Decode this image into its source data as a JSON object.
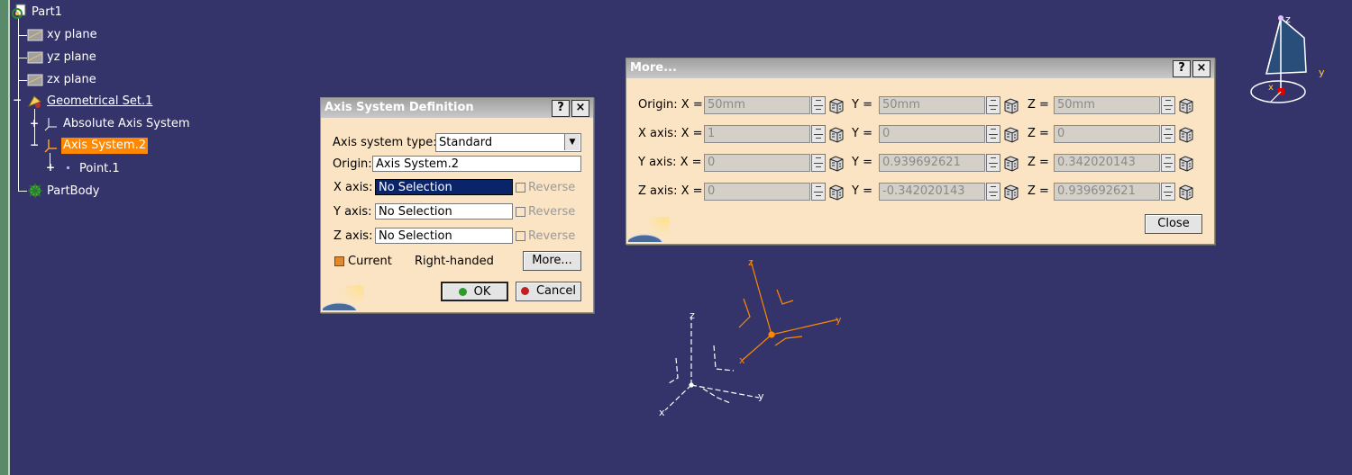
{
  "tree": {
    "root": "Part1",
    "items": [
      {
        "label": "xy plane"
      },
      {
        "label": "yz plane"
      },
      {
        "label": "zx plane"
      },
      {
        "label": "Geometrical Set.1"
      },
      {
        "label": "Absolute Axis System"
      },
      {
        "label": "Axis System.2"
      },
      {
        "label": "Point.1"
      },
      {
        "label": "PartBody"
      }
    ]
  },
  "axis_dialog": {
    "title": "Axis System Definition",
    "help": "?",
    "close": "×",
    "type_label": "Axis system type:",
    "type_value": "Standard",
    "origin_label": "Origin:",
    "origin_value": "Axis System.2",
    "x_label": "X axis:",
    "x_value": "No Selection",
    "y_label": "Y axis:",
    "y_value": "No Selection",
    "z_label": "Z axis:",
    "z_value": "No Selection",
    "reverse": "Reverse",
    "current": "Current",
    "handed": "Right-handed",
    "more": "More...",
    "ok": "OK",
    "cancel": "Cancel"
  },
  "more_dialog": {
    "title": "More...",
    "help": "?",
    "close": "×",
    "rows": [
      {
        "label": "Origin: X =",
        "x": "50mm",
        "y": "50mm",
        "z": "50mm"
      },
      {
        "label": "X axis: X =",
        "x": "1",
        "y": "0",
        "z": "0"
      },
      {
        "label": "Y axis: X =",
        "x": "0",
        "y": "0.939692621",
        "z": "0.342020143"
      },
      {
        "label": "Z axis: X =",
        "x": "0",
        "y": "-0.342020143",
        "z": "0.939692621"
      }
    ],
    "y_eq": "Y =",
    "z_eq": "Z =",
    "close_btn": "Close"
  },
  "viewport": {
    "axis_x": "x",
    "axis_y": "y",
    "axis_z": "z",
    "highlight_color": "#ff8800"
  }
}
